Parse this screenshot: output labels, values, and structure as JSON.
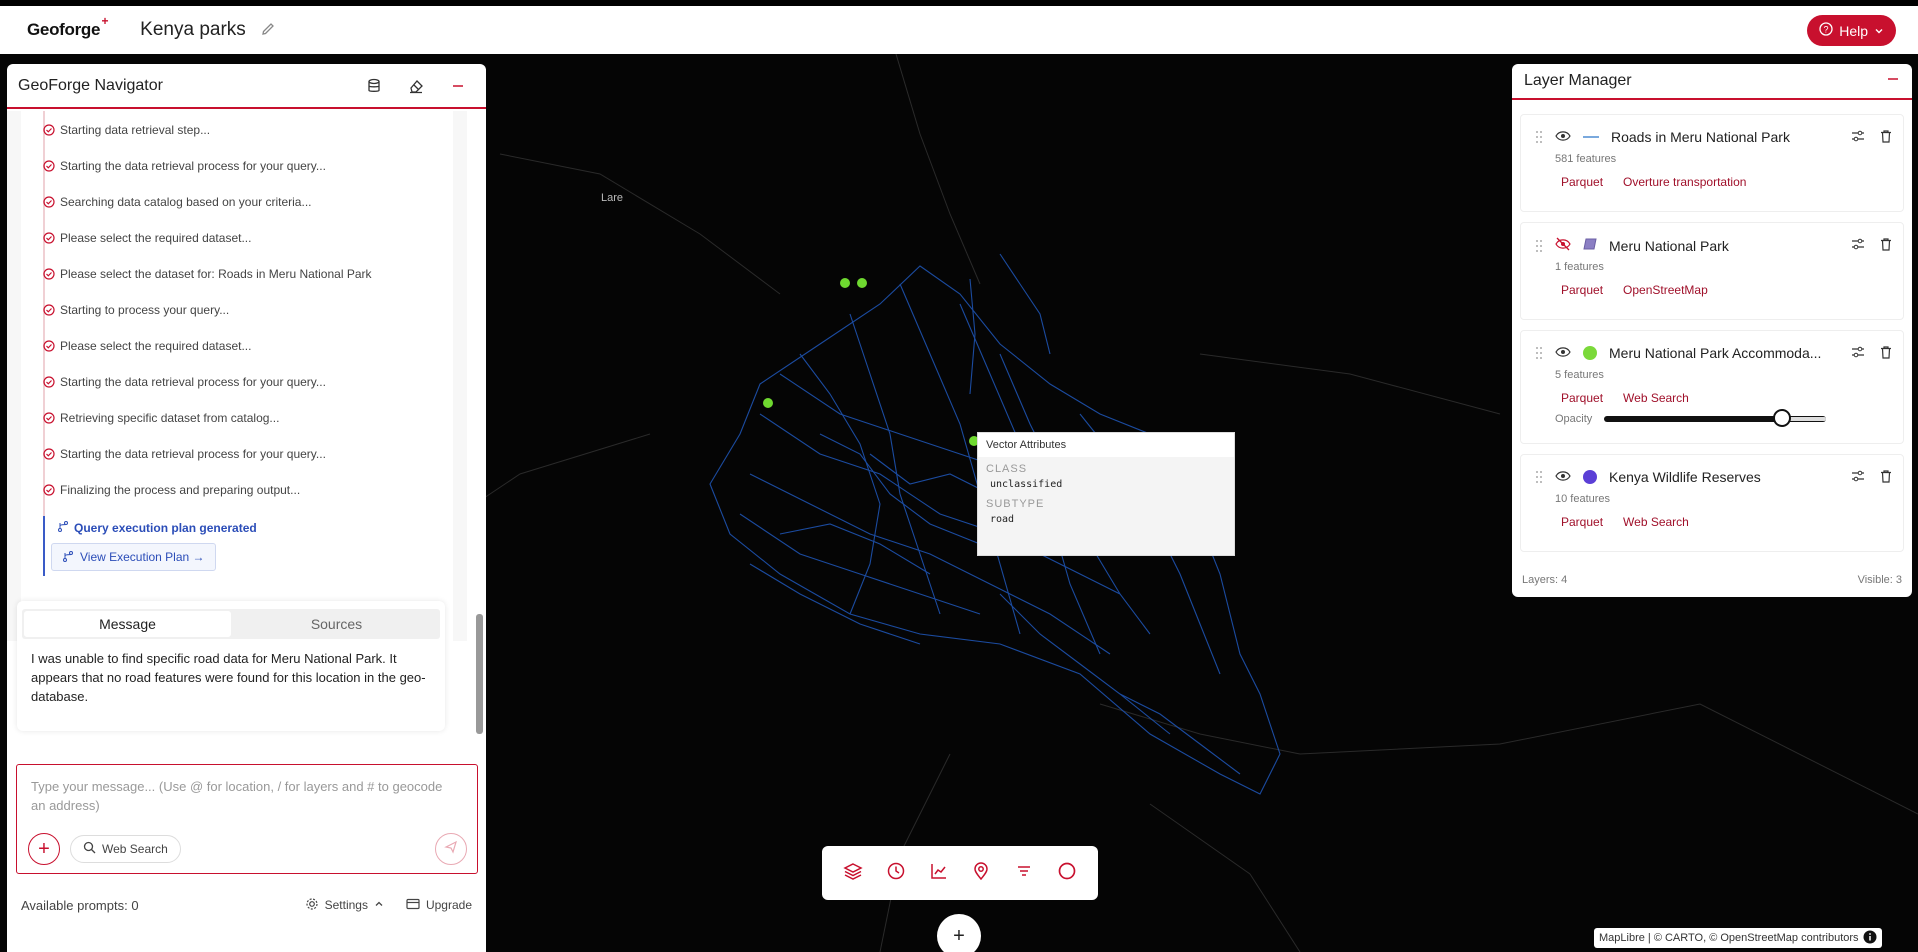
{
  "app": {
    "logo": "Geoforge",
    "logo_plus": "+",
    "project_title": "Kenya parks",
    "help_label": "Help"
  },
  "navigator": {
    "title": "GeoForge Navigator",
    "steps": [
      "Starting data retrieval step...",
      "Starting the data retrieval process for your query...",
      "Searching data catalog based on your criteria...",
      "Please select the required dataset...",
      "Please select the dataset for: Roads in Meru National Park",
      "Starting to process your query...",
      "Please select the required dataset...",
      "Starting the data retrieval process for your query...",
      "Retrieving specific dataset from catalog...",
      "Starting the data retrieval process for your query...",
      "Finalizing the process and preparing output..."
    ],
    "plan_generated": "Query execution plan generated",
    "view_plan": "View Execution Plan →",
    "tabs": {
      "message": "Message",
      "sources": "Sources"
    },
    "message": "I was unable to find specific road data for Meru National Park. It appears that no road features were found for this location in the geo-database.",
    "input_placeholder": "Type your message... (Use @ for location, / for layers and # to geocode an address)",
    "web_search": "Web Search",
    "available_prompts": "Available prompts: 0",
    "settings": "Settings",
    "upgrade": "Upgrade"
  },
  "layer_manager": {
    "title": "Layer Manager",
    "layers": [
      {
        "name": "Roads in Meru National Park",
        "count": "581 features",
        "format": "Parquet",
        "source": "Overture transportation",
        "color": "#7aa9dd",
        "swatch": "line",
        "visible": true
      },
      {
        "name": "Meru National Park",
        "count": "1 features",
        "format": "Parquet",
        "source": "OpenStreetMap",
        "color": "#8b7fc4",
        "swatch": "polygon",
        "visible": false
      },
      {
        "name": "Meru National Park Accommoda...",
        "count": "5 features",
        "format": "Parquet",
        "source": "Web Search",
        "color": "#7bd93a",
        "swatch": "dot",
        "visible": true
      },
      {
        "name": "Kenya Wildlife Reserves",
        "count": "10 features",
        "format": "Parquet",
        "source": "Web Search",
        "color": "#5b3fd6",
        "swatch": "dot",
        "visible": true
      }
    ],
    "opacity_label": "Opacity",
    "opacity_value": 0.8,
    "layers_count": "Layers: 4",
    "visible_count": "Visible: 3"
  },
  "map": {
    "place_label": "Lare",
    "popup": {
      "title": "Vector Attributes",
      "class_key": "CLASS",
      "class_val": "unclassified",
      "subtype_key": "SUBTYPE",
      "subtype_val": "road"
    },
    "attribution": "MapLibre | © CARTO, © OpenStreetMap contributors"
  }
}
